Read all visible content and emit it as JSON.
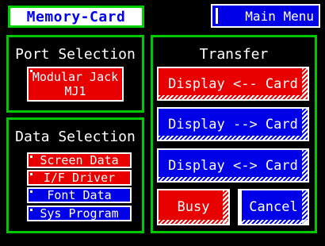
{
  "header": {
    "title": "Memory-Card",
    "main_menu_label": "Main Menu"
  },
  "port_selection": {
    "title": "Port Selection",
    "selected_line1": "Modular Jack",
    "selected_line2": "MJ1"
  },
  "data_selection": {
    "title": "Data Selection",
    "items": [
      {
        "label": "Screen Data",
        "state": "red"
      },
      {
        "label": "I/F Driver",
        "state": "red"
      },
      {
        "label": "Font Data",
        "state": "blue"
      },
      {
        "label": "Sys Program",
        "state": "blue"
      }
    ]
  },
  "transfer": {
    "title": "Transfer",
    "buttons": [
      {
        "label": "Display <-- Card",
        "state": "red"
      },
      {
        "label": "Display --> Card",
        "state": "blue"
      },
      {
        "label": "Display <-> Card",
        "state": "blue"
      }
    ],
    "busy_label": "Busy",
    "cancel_label": "Cancel"
  },
  "colors": {
    "panel_border": "#00c800",
    "red": "#e80000",
    "blue": "#0000e8",
    "background": "#000000"
  }
}
